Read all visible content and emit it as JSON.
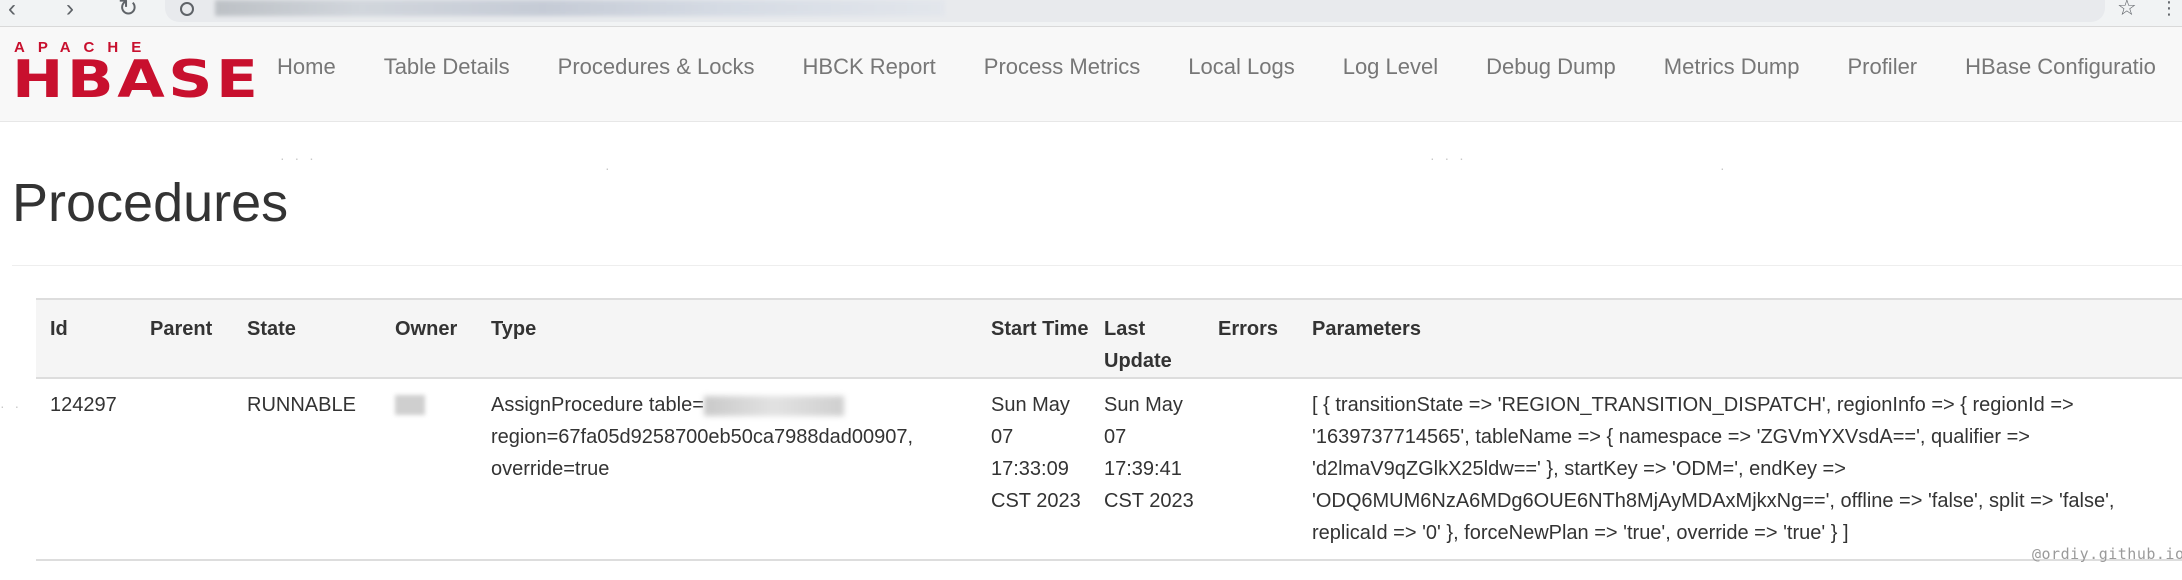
{
  "browser": {
    "back_glyph": "‹",
    "forward_glyph": "›",
    "reload_glyph": "↻",
    "bookmark_glyph": "☆",
    "menu_glyph": "⋮",
    "icons": [
      "back-arrow-icon",
      "forward-arrow-icon",
      "reload-icon",
      "info-icon",
      "bookmark-star-icon",
      "menu-icon"
    ]
  },
  "logo": {
    "top": "APACHE",
    "main": "HBASE",
    "color": "#c8102e"
  },
  "nav": {
    "items": [
      {
        "label": "Home"
      },
      {
        "label": "Table Details"
      },
      {
        "label": "Procedures & Locks"
      },
      {
        "label": "HBCK Report"
      },
      {
        "label": "Process Metrics"
      },
      {
        "label": "Local Logs"
      },
      {
        "label": "Log Level"
      },
      {
        "label": "Debug Dump"
      },
      {
        "label": "Metrics Dump"
      },
      {
        "label": "Profiler"
      },
      {
        "label": "HBase Configuratio"
      }
    ]
  },
  "page": {
    "title": "Procedures"
  },
  "table": {
    "columns": [
      "Id",
      "Parent",
      "State",
      "Owner",
      "Type",
      "Start Time",
      "Last Update",
      "Errors",
      "Parameters"
    ],
    "rows": [
      {
        "id": "124297",
        "parent": "",
        "state": "RUNNABLE",
        "owner": "",
        "type_prefix": "AssignProcedure table=",
        "type_rest": "region=67fa05d9258700eb50ca7988dad00907, override=true",
        "start_time": "Sun May 07 17:33:09 CST 2023",
        "last_update": "Sun May 07 17:39:41 CST 2023",
        "errors": "",
        "parameters": "[ { transitionState => 'REGION_TRANSITION_DISPATCH', regionInfo => { regionId => '1639737714565', tableName => { namespace => 'ZGVmYXVsdA==', qualifier => 'd2lmaV9qZGlkX25ldw==' }, startKey => 'ODM=', endKey => 'ODQ6MUM6NzA6MDg6OUE6NTh8MjAyMDAxMjkxNg==', offline => 'false', split => 'false', replicaId => '0' }, forceNewPlan => 'true', override => 'true' } ]"
      }
    ]
  },
  "watermark": "@ordiy.github.io"
}
